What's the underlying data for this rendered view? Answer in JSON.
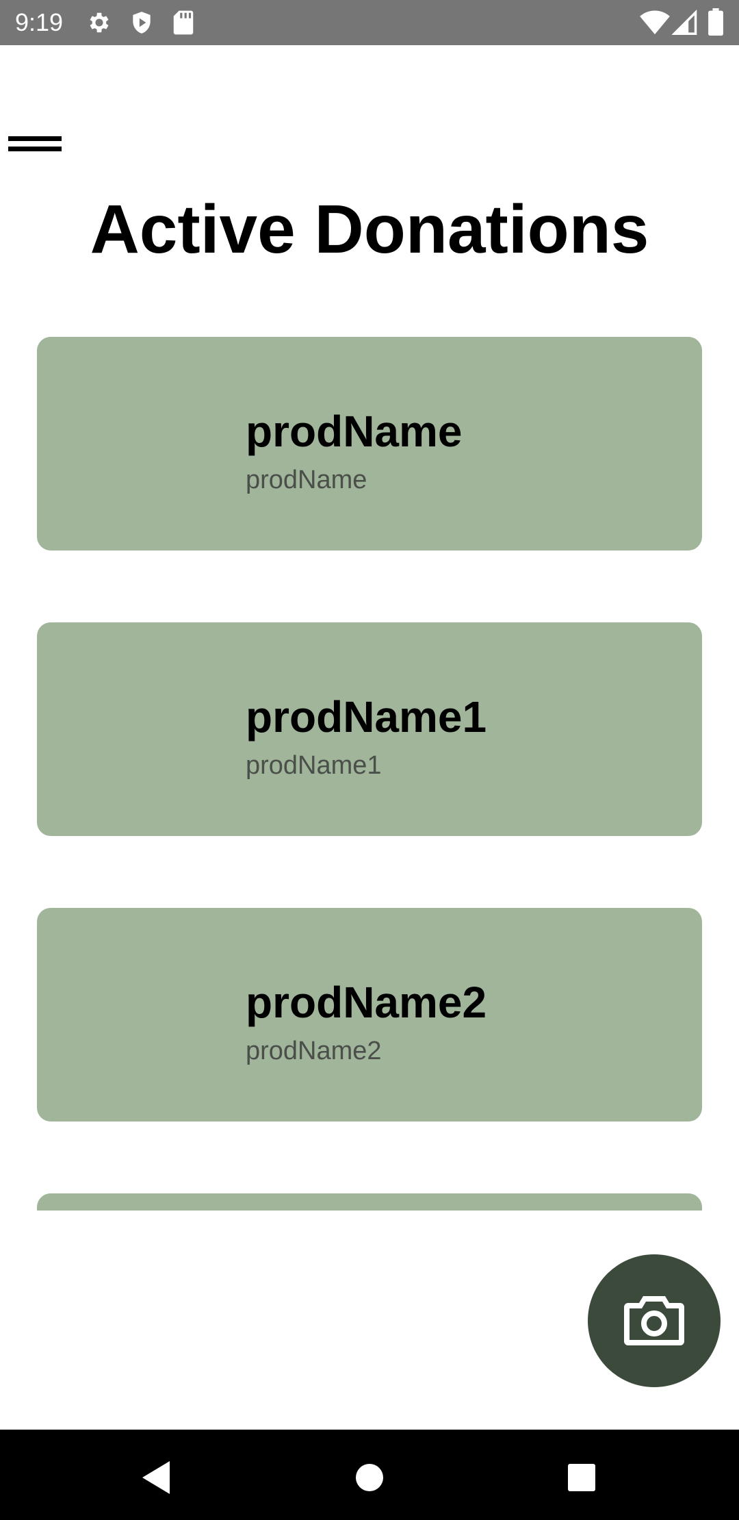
{
  "status_bar": {
    "time": "9:19",
    "background": "#767676",
    "left_icons": [
      "gear-icon",
      "shield-play-icon",
      "sd-card-icon"
    ],
    "right_icons": [
      "wifi-icon",
      "cellular-signal-icon",
      "battery-icon"
    ]
  },
  "header": {
    "menu_icon": "menu-icon",
    "title": "Active Donations"
  },
  "donations": [
    {
      "title": "prodName",
      "subtitle": "prodName"
    },
    {
      "title": "prodName1",
      "subtitle": "prodName1"
    },
    {
      "title": "prodName2",
      "subtitle": "prodName2"
    },
    {
      "title": "",
      "subtitle": ""
    }
  ],
  "fab": {
    "icon": "camera-icon"
  },
  "nav_bar": {
    "buttons": [
      "back-icon",
      "home-icon",
      "recents-icon"
    ]
  },
  "colors": {
    "card_background": "#a1b59b",
    "fab_background": "#3c4a3c",
    "nav_background": "#000000"
  }
}
